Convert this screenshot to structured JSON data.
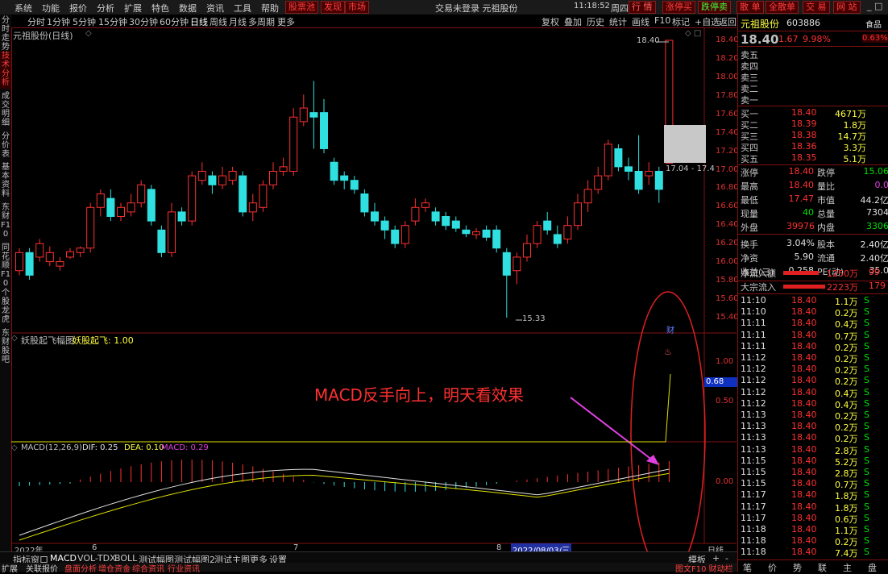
{
  "topmenu": {
    "items": [
      "系统",
      "功能",
      "报价",
      "分析",
      "扩展",
      "特色",
      "数据",
      "资讯",
      "工具",
      "帮助"
    ],
    "red_buttons": [
      "股票池",
      "发现",
      "市场"
    ],
    "center_text": "交易未登录  元祖股份",
    "time": "11:18:52",
    "weekday": "周四",
    "right_buttons": [
      "行 情",
      "涨停买",
      "跌停卖",
      "散 单",
      "全散单",
      "交 易",
      "网 站"
    ]
  },
  "periodbar": {
    "periods": [
      "分时",
      "1分钟",
      "5分钟",
      "15分钟",
      "30分钟",
      "60分钟",
      "日线",
      "周线",
      "月线",
      "多周期",
      "更多"
    ],
    "active": "日线",
    "tools": [
      "复权",
      "叠加",
      "历史",
      "统计",
      "画线",
      "F10",
      "标记",
      "+自选",
      "返回"
    ]
  },
  "lefttabs": [
    "分时走势",
    "技术分析",
    "成交明细",
    "分价表",
    "基本资料",
    "东财F10",
    "同花顺F10",
    "个股龙虎",
    "东财股吧"
  ],
  "chart": {
    "title": "元祖股份(日线)",
    "main_ticks": [
      "18.40",
      "18.20",
      "18.00",
      "17.80",
      "17.60",
      "17.40",
      "17.20",
      "17.00",
      "16.80",
      "16.60",
      "16.40",
      "16.20",
      "16.00",
      "15.80",
      "15.60",
      "15.40"
    ],
    "high_label": "18.40",
    "low_label": "15.33",
    "box_label": "17.04 - 17.4",
    "ind1_name": "妖股起飞幅图",
    "ind1_label": "妖股起飞: 1.00",
    "ind1_ticks": [
      "1.00",
      "0.50"
    ],
    "ind1_value": "0.68",
    "ind1_cai": "财",
    "macd_label": "MACD(12,26,9)",
    "macd_dif": "DIF: 0.25",
    "macd_dea": "DEA: 0.10",
    "macd_macd": "MACD: 0.29",
    "macd_tick": "0.00",
    "annotation": "MACD反手向上，明天看效果",
    "dates": [
      "2022年",
      "6",
      "7",
      "8"
    ],
    "date_highlight": "2022/08/03/三",
    "period_label": "日线"
  },
  "chart_data": {
    "type": "candlestick",
    "ylim": [
      15.33,
      18.4
    ],
    "candles": [
      {
        "o": 15.85,
        "c": 16.05,
        "h": 16.1,
        "l": 15.8
      },
      {
        "o": 16.05,
        "c": 15.8,
        "h": 16.1,
        "l": 15.75
      },
      {
        "o": 16.0,
        "c": 16.15,
        "h": 16.2,
        "l": 15.95
      },
      {
        "o": 15.95,
        "c": 16.05,
        "h": 16.12,
        "l": 15.9
      },
      {
        "o": 15.9,
        "c": 15.95,
        "h": 16.0,
        "l": 15.85
      },
      {
        "o": 16.0,
        "c": 16.06,
        "h": 16.1,
        "l": 15.98
      },
      {
        "o": 16.05,
        "c": 16.1,
        "h": 16.12,
        "l": 16.0
      },
      {
        "o": 16.1,
        "c": 16.55,
        "h": 16.6,
        "l": 16.05
      },
      {
        "o": 16.55,
        "c": 16.7,
        "h": 16.75,
        "l": 16.45
      },
      {
        "o": 16.65,
        "c": 16.45,
        "h": 16.75,
        "l": 16.4
      },
      {
        "o": 16.45,
        "c": 16.55,
        "h": 16.6,
        "l": 16.4
      },
      {
        "o": 16.5,
        "c": 16.6,
        "h": 16.7,
        "l": 16.45
      },
      {
        "o": 16.6,
        "c": 16.8,
        "h": 16.85,
        "l": 16.55
      },
      {
        "o": 16.75,
        "c": 16.4,
        "h": 16.8,
        "l": 16.35
      },
      {
        "o": 16.3,
        "c": 16.05,
        "h": 16.35,
        "l": 16.0
      },
      {
        "o": 16.05,
        "c": 16.5,
        "h": 16.6,
        "l": 16.0
      },
      {
        "o": 16.5,
        "c": 16.4,
        "h": 16.55,
        "l": 16.35
      },
      {
        "o": 16.4,
        "c": 16.9,
        "h": 16.95,
        "l": 16.35
      },
      {
        "o": 16.85,
        "c": 16.95,
        "h": 17.05,
        "l": 16.8
      },
      {
        "o": 16.9,
        "c": 16.8,
        "h": 16.95,
        "l": 16.7
      },
      {
        "o": 16.8,
        "c": 16.9,
        "h": 17.0,
        "l": 16.75
      },
      {
        "o": 16.85,
        "c": 16.95,
        "h": 17.0,
        "l": 16.8
      },
      {
        "o": 16.9,
        "c": 16.5,
        "h": 16.95,
        "l": 16.45
      },
      {
        "o": 16.5,
        "c": 16.6,
        "h": 16.7,
        "l": 16.4
      },
      {
        "o": 16.55,
        "c": 16.8,
        "h": 16.85,
        "l": 16.5
      },
      {
        "o": 16.8,
        "c": 16.95,
        "h": 17.05,
        "l": 16.75
      },
      {
        "o": 16.95,
        "c": 17.0,
        "h": 17.1,
        "l": 16.9
      },
      {
        "o": 16.95,
        "c": 17.55,
        "h": 17.65,
        "l": 16.9
      },
      {
        "o": 17.5,
        "c": 17.65,
        "h": 17.8,
        "l": 17.45
      },
      {
        "o": 17.6,
        "c": 17.55,
        "h": 17.95,
        "l": 17.2
      },
      {
        "o": 17.6,
        "c": 17.2,
        "h": 17.75,
        "l": 17.15
      },
      {
        "o": 17.05,
        "c": 16.85,
        "h": 17.1,
        "l": 16.8
      },
      {
        "o": 16.9,
        "c": 16.85,
        "h": 16.95,
        "l": 16.75
      },
      {
        "o": 16.85,
        "c": 16.75,
        "h": 16.9,
        "l": 16.7
      },
      {
        "o": 16.7,
        "c": 16.5,
        "h": 16.75,
        "l": 16.45
      },
      {
        "o": 16.5,
        "c": 16.4,
        "h": 16.6,
        "l": 16.35
      },
      {
        "o": 16.4,
        "c": 16.3,
        "h": 16.45,
        "l": 16.2
      },
      {
        "o": 16.3,
        "c": 16.15,
        "h": 16.35,
        "l": 16.1
      },
      {
        "o": 16.15,
        "c": 16.35,
        "h": 16.4,
        "l": 16.1
      },
      {
        "o": 16.4,
        "c": 16.55,
        "h": 16.65,
        "l": 16.35
      },
      {
        "o": 16.55,
        "c": 16.6,
        "h": 16.65,
        "l": 16.5
      },
      {
        "o": 16.5,
        "c": 16.4,
        "h": 16.55,
        "l": 16.35
      },
      {
        "o": 16.45,
        "c": 16.35,
        "h": 16.5,
        "l": 16.3
      },
      {
        "o": 16.4,
        "c": 16.32,
        "h": 16.45,
        "l": 16.28
      },
      {
        "o": 16.3,
        "c": 16.26,
        "h": 16.35,
        "l": 16.22
      },
      {
        "o": 16.25,
        "c": 16.28,
        "h": 16.32,
        "l": 16.2
      },
      {
        "o": 16.3,
        "c": 16.22,
        "h": 16.35,
        "l": 16.18
      },
      {
        "o": 16.3,
        "c": 16.1,
        "h": 16.35,
        "l": 16.05
      },
      {
        "o": 16.05,
        "c": 15.8,
        "h": 16.1,
        "l": 15.33
      },
      {
        "o": 15.85,
        "c": 16.0,
        "h": 16.05,
        "l": 15.7
      },
      {
        "o": 16.0,
        "c": 16.15,
        "h": 16.25,
        "l": 15.95
      },
      {
        "o": 16.15,
        "c": 16.35,
        "h": 16.4,
        "l": 16.1
      },
      {
        "o": 16.4,
        "c": 16.3,
        "h": 16.5,
        "l": 16.25
      },
      {
        "o": 16.25,
        "c": 16.15,
        "h": 16.35,
        "l": 16.1
      },
      {
        "o": 16.2,
        "c": 16.35,
        "h": 16.45,
        "l": 16.15
      },
      {
        "o": 16.35,
        "c": 16.6,
        "h": 16.7,
        "l": 16.3
      },
      {
        "o": 16.6,
        "c": 16.75,
        "h": 16.85,
        "l": 16.5
      },
      {
        "o": 16.75,
        "c": 16.9,
        "h": 17.0,
        "l": 16.7
      },
      {
        "o": 16.9,
        "c": 17.25,
        "h": 17.3,
        "l": 16.85
      },
      {
        "o": 17.2,
        "c": 17.0,
        "h": 17.25,
        "l": 16.95
      },
      {
        "o": 17.0,
        "c": 16.95,
        "h": 17.1,
        "l": 16.85
      },
      {
        "o": 16.95,
        "c": 16.75,
        "h": 17.35,
        "l": 16.7
      },
      {
        "o": 16.9,
        "c": 16.95,
        "h": 17.05,
        "l": 16.8
      },
      {
        "o": 16.95,
        "c": 16.75,
        "h": 17.0,
        "l": 16.6
      },
      {
        "o": 17.04,
        "c": 18.4,
        "h": 18.4,
        "l": 17.04
      }
    ],
    "ind1": {
      "value": 0.68,
      "max": 1.0
    },
    "macd": {
      "dif": 0.25,
      "dea": 0.1,
      "macd": 0.29
    }
  },
  "quote": {
    "name": "元祖股份",
    "code": "603886",
    "price": "18.40",
    "change": "1.67",
    "pct": "9.98%",
    "tag1": "食品",
    "tag1_value": "0.63%",
    "sell_labels": [
      "卖五",
      "卖四",
      "卖三",
      "卖二",
      "卖一"
    ],
    "buy_rows": [
      {
        "label": "买一",
        "price": "18.40",
        "vol": "4671万"
      },
      {
        "label": "买二",
        "price": "18.39",
        "vol": "1.8万"
      },
      {
        "label": "买三",
        "price": "18.38",
        "vol": "14.7万"
      },
      {
        "label": "买四",
        "price": "18.36",
        "vol": "3.3万"
      },
      {
        "label": "买五",
        "price": "18.35",
        "vol": "5.1万"
      }
    ],
    "stats": [
      {
        "l1": "涨停",
        "v1": "18.40",
        "l2": "跌停",
        "v2": "15.06"
      },
      {
        "l1": "最高",
        "v1": "18.40",
        "l2": "量比",
        "v2": "0.0"
      },
      {
        "l1": "最低",
        "v1": "17.47",
        "l2": "市值",
        "v2": "44.2亿"
      },
      {
        "l1": "现量",
        "v1": "40",
        "l2": "总量",
        "v2": "7304"
      },
      {
        "l1": "外盘",
        "v1": "39976",
        "l2": "内盘",
        "v2": "3306"
      },
      {
        "l1": "换手",
        "v1": "3.04%",
        "l2": "股本",
        "v2": "2.40亿"
      },
      {
        "l1": "净资",
        "v1": "5.90",
        "l2": "流通",
        "v2": "2.40亿"
      },
      {
        "l1": "收益(三)",
        "v1": "0.258",
        "l2": "PE(动)",
        "v2": "35.0"
      }
    ],
    "flows": [
      {
        "label": "净流入额",
        "value": "1250万",
        "extra": "99"
      },
      {
        "label": "大宗流入",
        "value": "2223万",
        "extra": "179"
      }
    ],
    "ticks": [
      {
        "t": "11:10",
        "p": "18.40",
        "v": "1.1万",
        "s": "S"
      },
      {
        "t": "11:10",
        "p": "18.40",
        "v": "0.2万",
        "s": "S"
      },
      {
        "t": "11:11",
        "p": "18.40",
        "v": "0.4万",
        "s": "S"
      },
      {
        "t": "11:11",
        "p": "18.40",
        "v": "0.7万",
        "s": "S"
      },
      {
        "t": "11:11",
        "p": "18.40",
        "v": "0.2万",
        "s": "S"
      },
      {
        "t": "11:12",
        "p": "18.40",
        "v": "0.2万",
        "s": "S"
      },
      {
        "t": "11:12",
        "p": "18.40",
        "v": "0.2万",
        "s": "S"
      },
      {
        "t": "11:12",
        "p": "18.40",
        "v": "0.2万",
        "s": "S"
      },
      {
        "t": "11:12",
        "p": "18.40",
        "v": "0.4万",
        "s": "S"
      },
      {
        "t": "11:12",
        "p": "18.40",
        "v": "0.4万",
        "s": "S"
      },
      {
        "t": "11:13",
        "p": "18.40",
        "v": "0.2万",
        "s": "S"
      },
      {
        "t": "11:13",
        "p": "18.40",
        "v": "0.2万",
        "s": "S"
      },
      {
        "t": "11:13",
        "p": "18.40",
        "v": "0.2万",
        "s": "S"
      },
      {
        "t": "11:13",
        "p": "18.40",
        "v": "2.8万",
        "s": "S"
      },
      {
        "t": "11:15",
        "p": "18.40",
        "v": "5.2万",
        "s": "S"
      },
      {
        "t": "11:15",
        "p": "18.40",
        "v": "2.8万",
        "s": "S"
      },
      {
        "t": "11:15",
        "p": "18.40",
        "v": "0.7万",
        "s": "S"
      },
      {
        "t": "11:17",
        "p": "18.40",
        "v": "1.8万",
        "s": "S"
      },
      {
        "t": "11:17",
        "p": "18.40",
        "v": "1.8万",
        "s": "S"
      },
      {
        "t": "11:17",
        "p": "18.40",
        "v": "0.6万",
        "s": "S"
      },
      {
        "t": "11:18",
        "p": "18.40",
        "v": "1.1万",
        "s": "S"
      },
      {
        "t": "11:18",
        "p": "18.40",
        "v": "0.2万",
        "s": "S"
      },
      {
        "t": "11:18",
        "p": "18.40",
        "v": "7.4万",
        "s": "S"
      }
    ],
    "bottom_tabs": [
      "笔",
      "价",
      "势",
      "联",
      "主",
      "盘"
    ]
  },
  "bottomtabs": [
    "指标",
    "窗口",
    "MACD",
    "VOL-TDX",
    "BOLL",
    "测试幅图",
    "测试幅图2",
    "测试主图",
    "更多",
    "设置"
  ],
  "bottomtabs_active": "MACD",
  "bottomtabs_right": [
    "模板",
    "+",
    "-"
  ],
  "bottombar": [
    "扩展",
    "关联报价",
    "盘面分析",
    "增仓资金",
    "综合资讯",
    "行业资讯"
  ],
  "bottombar_right": "图文F10 财动栏"
}
